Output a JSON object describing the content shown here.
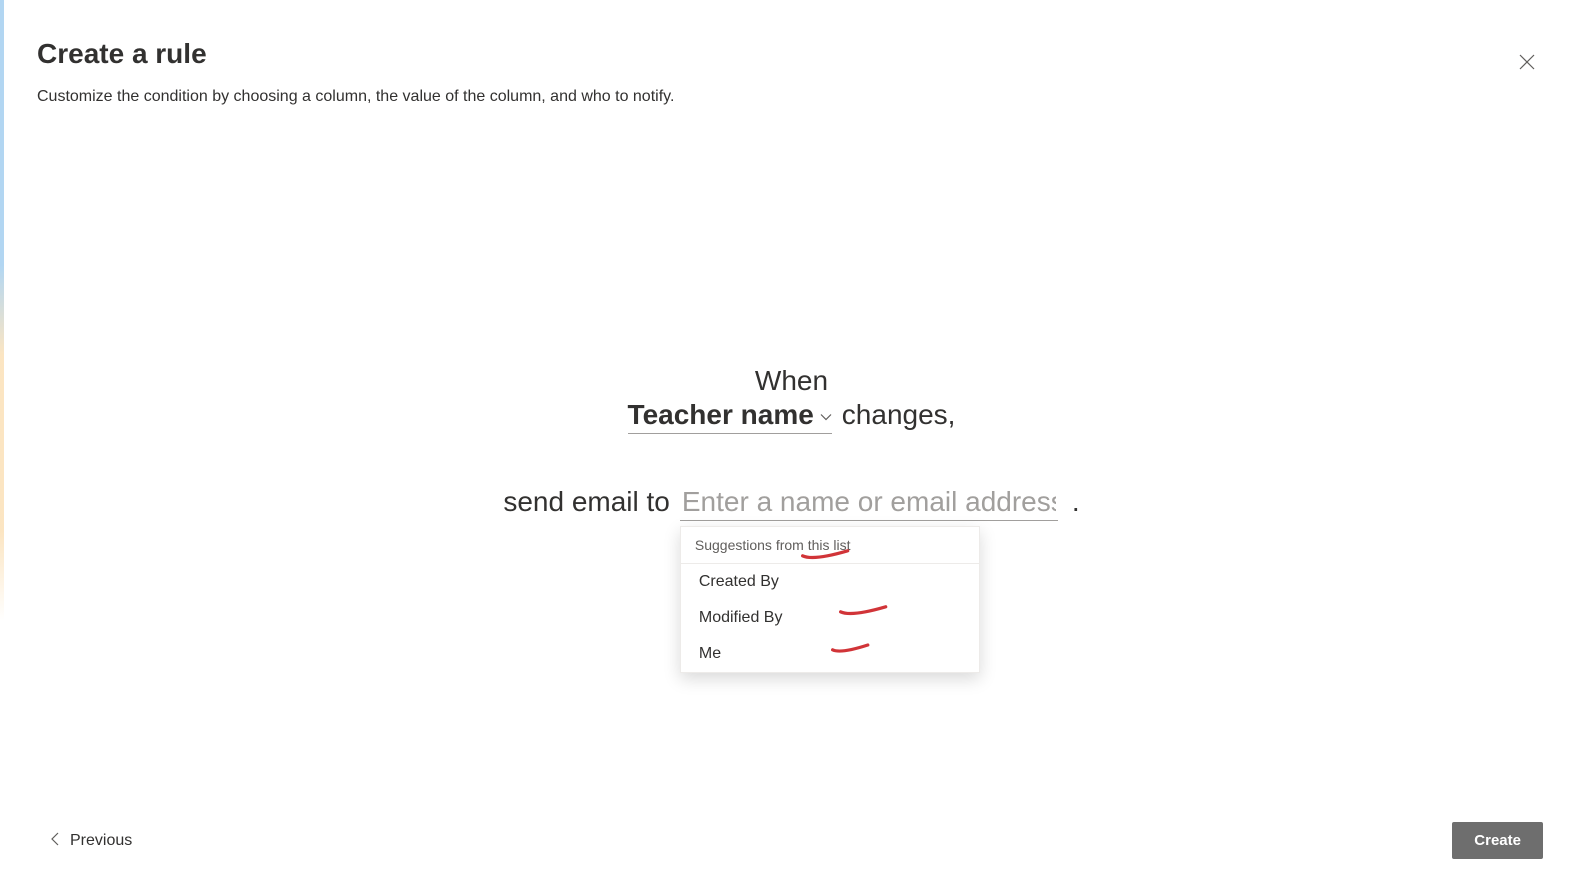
{
  "header": {
    "title": "Create a rule",
    "subtitle": "Customize the condition by choosing a column, the value of the column, and who to notify."
  },
  "ruleBuilder": {
    "whenLabel": "When",
    "columnSelection": "Teacher name",
    "changesLabel": "changes,",
    "sendEmailLabel": "send email to",
    "emailPlaceholder": "Enter a name or email address",
    "period": "."
  },
  "suggestions": {
    "header": "Suggestions from this list",
    "items": [
      "Created By",
      "Modified By",
      "Me"
    ]
  },
  "footer": {
    "previousLabel": "Previous",
    "createLabel": "Create"
  }
}
